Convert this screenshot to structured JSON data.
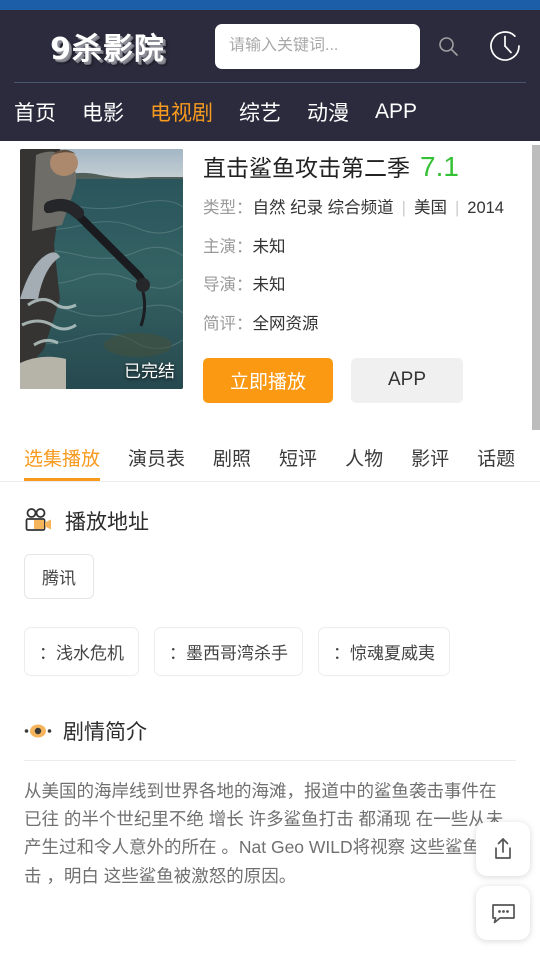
{
  "header": {
    "logo": "9杀影院",
    "search": {
      "placeholder": "请输入关键词...",
      "value": "",
      "icon": "search-icon"
    },
    "history_icon": "clock-icon",
    "nav": [
      {
        "label": "首页",
        "active": false
      },
      {
        "label": "电影",
        "active": false
      },
      {
        "label": "电视剧",
        "active": true
      },
      {
        "label": "综艺",
        "active": false
      },
      {
        "label": "动漫",
        "active": false
      },
      {
        "label": "APP",
        "active": false
      }
    ]
  },
  "detail": {
    "title": "直击鲨鱼攻击第二季",
    "rating": "7.1",
    "poster_badge": "已完结",
    "fields": {
      "type_label": "类型：",
      "genres": "自然 纪录 综合频道",
      "region": "美国",
      "year": "2014",
      "starring_label": "主演：",
      "starring": "未知",
      "director_label": "导演：",
      "director": "未知",
      "comment_label": "简评：",
      "comment": "全网资源"
    },
    "buttons": {
      "play": "立即播放",
      "app": "APP"
    }
  },
  "tabs": [
    {
      "label": "选集播放",
      "active": true
    },
    {
      "label": "演员表",
      "active": false
    },
    {
      "label": "剧照",
      "active": false
    },
    {
      "label": "短评",
      "active": false
    },
    {
      "label": "人物",
      "active": false
    },
    {
      "label": "影评",
      "active": false
    },
    {
      "label": "话题",
      "active": false
    }
  ],
  "play_source": {
    "heading": "播放地址",
    "icon": "video-camera-icon",
    "sources": [
      "腾讯"
    ],
    "episodes": [
      "：浅水危机",
      "：墨西哥湾杀手",
      "：惊魂夏威夷"
    ]
  },
  "synopsis": {
    "heading": "剧情简介",
    "icon": "eye-icon",
    "text": "从美国的海岸线到世界各地的海滩，报道中的鲨鱼袭击事件在已往 的半个世纪里不绝 增长 许多鲨鱼打击 都涌现 在一些从未产生过和令人意外的所在 。Nat Geo WILD将视察 这些鲨鱼打击 ，明白 这些鲨鱼被激怒的原因。"
  },
  "floating": {
    "share_icon": "share-icon",
    "comment_icon": "comment-icon"
  },
  "colors": {
    "accent": "#f79a1e",
    "play_button": "#fb9a12",
    "header_bg": "#2b2b3d",
    "top_strip": "#1c5fa8",
    "rating_green": "#35c135"
  }
}
